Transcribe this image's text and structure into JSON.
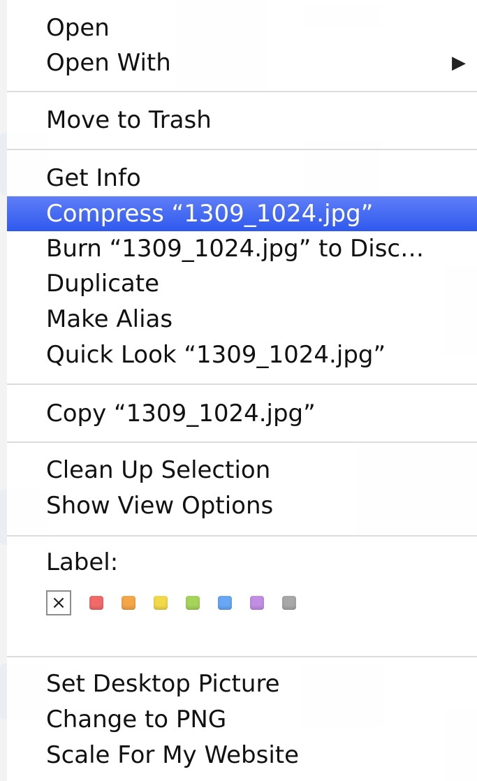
{
  "menu": {
    "group_open": [
      {
        "label": "Open"
      },
      {
        "label": "Open With",
        "submenu_glyph": "▶"
      }
    ],
    "group_trash": [
      {
        "label": "Move to Trash"
      }
    ],
    "group_info": [
      {
        "label": "Get Info"
      },
      {
        "label": "Compress “1309_1024.jpg”",
        "highlighted": true
      },
      {
        "label": "Burn “1309_1024.jpg” to Disc…"
      },
      {
        "label": "Duplicate"
      },
      {
        "label": "Make Alias"
      },
      {
        "label": "Quick Look “1309_1024.jpg”"
      }
    ],
    "group_copy": [
      {
        "label": "Copy “1309_1024.jpg”"
      }
    ],
    "group_view": [
      {
        "label": "Clean Up Selection"
      },
      {
        "label": "Show View Options"
      }
    ],
    "label_section": {
      "title": "Label:",
      "none_glyph": "×",
      "colors": [
        {
          "name": "red",
          "hex": "#f06a6a"
        },
        {
          "name": "orange",
          "hex": "#f5a649"
        },
        {
          "name": "yellow",
          "hex": "#f2d94a"
        },
        {
          "name": "green",
          "hex": "#a6d45b"
        },
        {
          "name": "blue",
          "hex": "#67a7f3"
        },
        {
          "name": "purple",
          "hex": "#c18ee3"
        },
        {
          "name": "gray",
          "hex": "#a8a8a8"
        }
      ]
    },
    "group_services": [
      {
        "label": "Set Desktop Picture"
      },
      {
        "label": "Change to PNG"
      },
      {
        "label": "Scale For My Website"
      }
    ],
    "highlight_color": "#3f68f1"
  }
}
